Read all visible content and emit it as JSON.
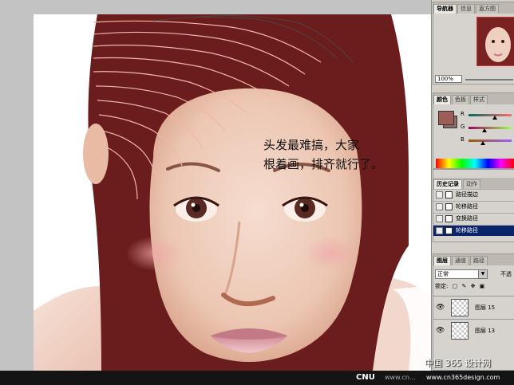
{
  "canvas": {
    "annotation": "头发最难搞，大家\n根着画，排齐就行了。"
  },
  "navigator_panel": {
    "tabs": [
      "导航器",
      "信息",
      "直方图"
    ],
    "zoom": "100%"
  },
  "color_panel": {
    "tabs": [
      "颜色",
      "色板",
      "样式"
    ],
    "channels": [
      {
        "label": "R",
        "value_pct": 0.61
      },
      {
        "label": "G",
        "value_pct": 0.37
      },
      {
        "label": "B",
        "value_pct": 0.34
      }
    ],
    "foreground_color": "#9d5e57"
  },
  "history_panel": {
    "tabs": [
      "历史记录",
      "动作"
    ],
    "rows": [
      "路径描边",
      "轮移路径",
      "变换路径",
      "轮移路径"
    ],
    "selected_index": 3
  },
  "layers_panel": {
    "tabs": [
      "图层",
      "通道",
      "路径"
    ],
    "blend_mode": "正常",
    "opacity_label": "不透",
    "lock_label": "锁定:",
    "layers": [
      {
        "name": "图层 15"
      },
      {
        "name": "图层 13"
      }
    ]
  },
  "watermark": {
    "cnu": "CNU",
    "site_url_left": "www.cn...",
    "chinese": "中国 365 设计网",
    "url": "www.cn365design.com"
  }
}
